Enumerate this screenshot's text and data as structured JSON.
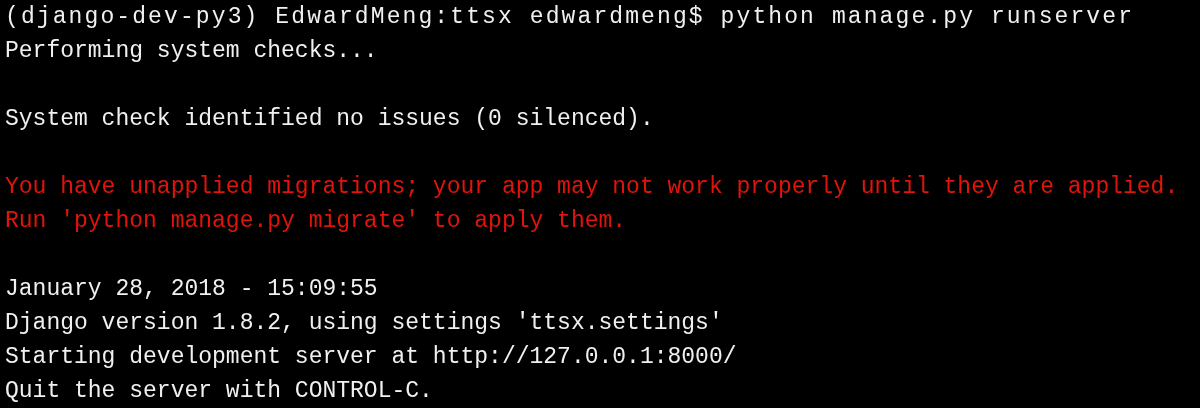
{
  "terminal": {
    "blocks": [
      {
        "kind": "output",
        "lines": [
          {
            "kind": "prompt",
            "text": "(django-dev-py3) EdwardMeng:ttsx edwardmeng$ python manage.py runserver"
          },
          {
            "kind": "plain",
            "text": "Performing system checks..."
          }
        ]
      },
      {
        "kind": "output",
        "lines": [
          {
            "kind": "plain",
            "text": "System check identified no issues (0 silenced)."
          }
        ]
      },
      {
        "kind": "error",
        "lines": [
          {
            "kind": "plain",
            "text": "You have unapplied migrations; your app may not work properly until they are applied."
          },
          {
            "kind": "plain",
            "text": "Run 'python manage.py migrate' to apply them."
          }
        ]
      },
      {
        "kind": "output",
        "lines": [
          {
            "kind": "plain",
            "text": "January 28, 2018 - 15:09:55"
          },
          {
            "kind": "plain",
            "text": "Django version 1.8.2, using settings 'ttsx.settings'"
          },
          {
            "kind": "plain",
            "text": "Starting development server at http://127.0.0.1:8000/"
          },
          {
            "kind": "plain",
            "text": "Quit the server with CONTROL-C."
          }
        ]
      }
    ]
  }
}
